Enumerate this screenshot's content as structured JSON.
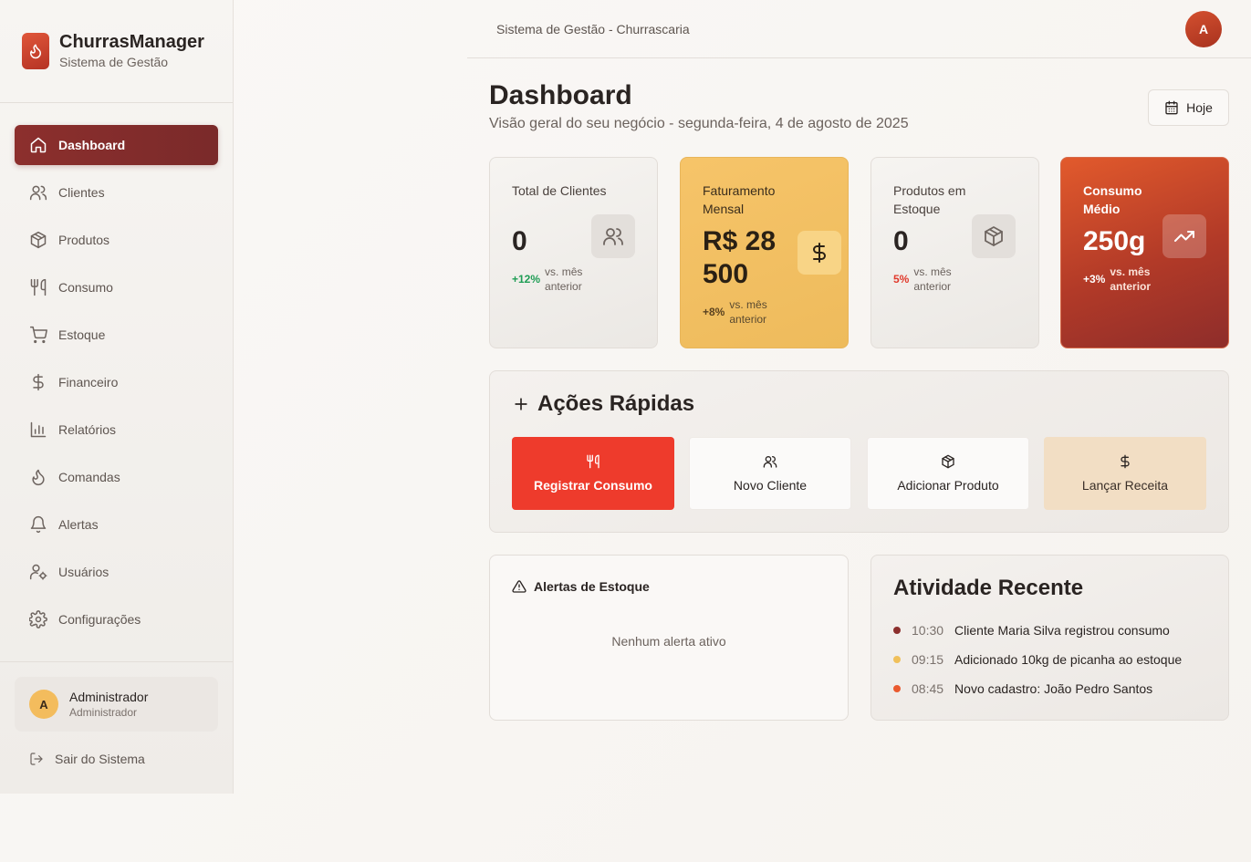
{
  "brand": {
    "title": "ChurrasManager",
    "subtitle": "Sistema de Gestão"
  },
  "nav": {
    "items": [
      {
        "label": "Dashboard",
        "icon": "home-icon",
        "active": true
      },
      {
        "label": "Clientes",
        "icon": "users-icon"
      },
      {
        "label": "Produtos",
        "icon": "package-icon"
      },
      {
        "label": "Consumo",
        "icon": "utensils-icon"
      },
      {
        "label": "Estoque",
        "icon": "cart-icon"
      },
      {
        "label": "Financeiro",
        "icon": "dollar-icon"
      },
      {
        "label": "Relatórios",
        "icon": "bar-chart-icon"
      },
      {
        "label": "Comandas",
        "icon": "flame-icon"
      },
      {
        "label": "Alertas",
        "icon": "bell-icon"
      },
      {
        "label": "Usuários",
        "icon": "user-cog-icon"
      },
      {
        "label": "Configurações",
        "icon": "gear-icon"
      }
    ]
  },
  "user": {
    "initial": "A",
    "name": "Administrador",
    "role": "Administrador"
  },
  "logout": {
    "label": "Sair do Sistema"
  },
  "topbar": {
    "title": "Sistema de Gestão - Churrascaria",
    "avatar_initial": "A"
  },
  "page": {
    "title": "Dashboard",
    "subtitle": "Visão geral do seu negócio - segunda-feira, 4 de agosto de 2025",
    "today_label": "Hoje"
  },
  "stats": [
    {
      "label": "Total de Clientes",
      "value": "0",
      "delta": "+12%",
      "vs": "vs. mês anterior",
      "delta_color": "#1f9d55",
      "icon": "users-icon"
    },
    {
      "label": "Faturamento Mensal",
      "value": "R$ 28 500",
      "delta": "+8%",
      "vs": "vs. mês anterior",
      "delta_color": "#5a4220",
      "icon": "dollar-icon"
    },
    {
      "label": "Produtos em Estoque",
      "value": "0",
      "delta": "5%",
      "vs": "vs. mês anterior",
      "delta_color": "#e0392b",
      "icon": "package-icon"
    },
    {
      "label": "Consumo Médio",
      "value": "250g",
      "delta": "+3%",
      "vs": "vs. mês anterior",
      "delta_color": "#ffffff",
      "icon": "trending-up-icon"
    }
  ],
  "quick_actions": {
    "title": "Ações Rápidas",
    "buttons": [
      {
        "label": "Registrar Consumo",
        "icon": "utensils-icon"
      },
      {
        "label": "Novo Cliente",
        "icon": "users-icon"
      },
      {
        "label": "Adicionar Produto",
        "icon": "package-icon"
      },
      {
        "label": "Lançar Receita",
        "icon": "dollar-icon"
      }
    ]
  },
  "stock_alerts": {
    "title": "Alertas de Estoque",
    "empty_text": "Nenhum alerta ativo"
  },
  "activity": {
    "title": "Atividade Recente",
    "items": [
      {
        "time": "10:30",
        "text": "Cliente Maria Silva registrou consumo",
        "color": "#8c2f2d"
      },
      {
        "time": "09:15",
        "text": "Adicionado 10kg de picanha ao estoque",
        "color": "#f0c05a"
      },
      {
        "time": "08:45",
        "text": "Novo cadastro: João Pedro Santos",
        "color": "#ea5a2f"
      }
    ]
  }
}
